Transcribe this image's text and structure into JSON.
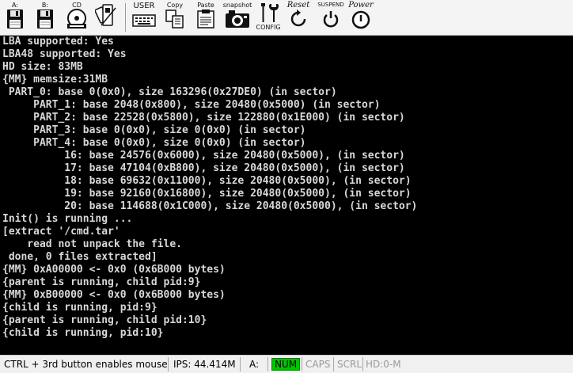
{
  "toolbar": {
    "items": [
      {
        "name": "floppy-a",
        "label": "A:"
      },
      {
        "name": "floppy-b",
        "label": "B:"
      },
      {
        "name": "cdrom",
        "label": "CD"
      },
      {
        "name": "usb",
        "label": ""
      },
      {
        "name": "user",
        "label": "USER"
      },
      {
        "name": "copy",
        "label": "Copy"
      },
      {
        "name": "paste",
        "label": "Paste"
      },
      {
        "name": "snapshot",
        "label": "snapshot"
      },
      {
        "name": "config",
        "label": "CONFIG"
      },
      {
        "name": "reset",
        "label": "Reset"
      },
      {
        "name": "suspend",
        "label": "SUSPEND"
      },
      {
        "name": "power",
        "label": "Power"
      }
    ]
  },
  "console": {
    "lines": [
      "LBA supported: Yes",
      "LBA48 supported: Yes",
      "HD size: 83MB",
      "{MM} memsize:31MB",
      " PART_0: base 0(0x0), size 163296(0x27DE0) (in sector)",
      "     PART_1: base 2048(0x800), size 20480(0x5000) (in sector)",
      "     PART_2: base 22528(0x5800), size 122880(0x1E000) (in sector)",
      "     PART_3: base 0(0x0), size 0(0x0) (in sector)",
      "     PART_4: base 0(0x0), size 0(0x0) (in sector)",
      "          16: base 24576(0x6000), size 20480(0x5000), (in sector)",
      "          17: base 47104(0xB800), size 20480(0x5000), (in sector)",
      "          18: base 69632(0x11000), size 20480(0x5000), (in sector)",
      "          19: base 92160(0x16800), size 20480(0x5000), (in sector)",
      "          20: base 114688(0x1C000), size 20480(0x5000), (in sector)",
      "Init() is running ...",
      "[extract '/cmd.tar'",
      "    read not unpack the file.",
      " done, 0 files extracted]",
      "{MM} 0xA00000 <- 0x0 (0x6B000 bytes)",
      "{parent is running, child pid:9}",
      "{MM} 0xB00000 <- 0x0 (0x6B000 bytes)",
      "{child is running, pid:9}",
      "{parent is running, child pid:10}",
      "{child is running, pid:10}"
    ]
  },
  "statusbar": {
    "hint": "CTRL + 3rd button enables mouse",
    "ips": "IPS: 44.414M",
    "drive_a": "A:",
    "num": "NUM",
    "caps": "CAPS",
    "scrl": "SCRL",
    "hd": "HD:0-M"
  },
  "colors": {
    "console_bg": "#000000",
    "console_fg": "#d8d8d8",
    "num_active": "#00c400"
  }
}
